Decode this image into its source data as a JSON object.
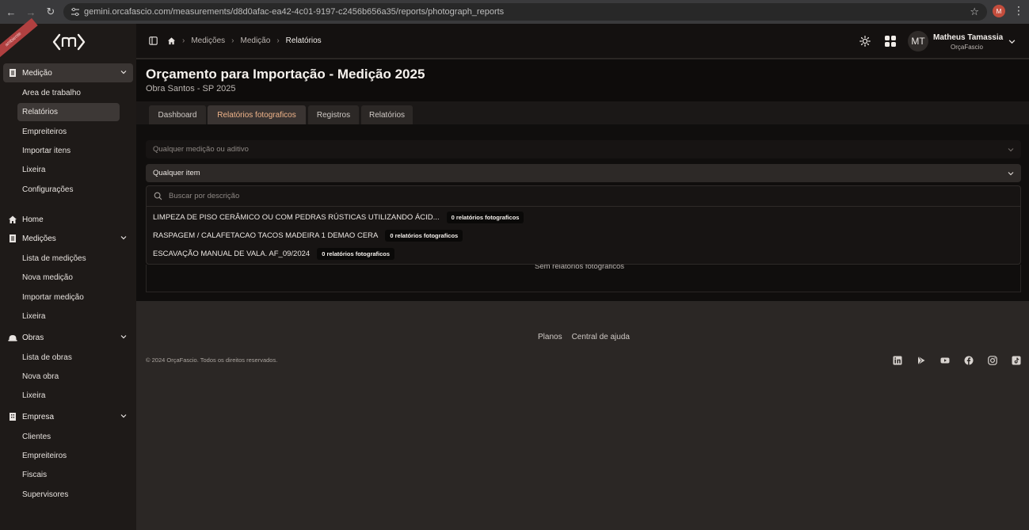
{
  "browser": {
    "url": "gemini.orcafascio.com/measurements/d8d0afac-ea42-4c01-9197-c2456b656a35/reports/photograph_reports",
    "profile_initial": "M"
  },
  "sidebar": {
    "ribbon": "ambiente",
    "sections": [
      {
        "label": "Medição",
        "items": [
          "Area de trabalho",
          "Relatórios",
          "Empreiteiros",
          "Importar itens",
          "Lixeira",
          "Configurações"
        ]
      },
      {
        "label": "Home",
        "items": []
      },
      {
        "label": "Medições",
        "items": [
          "Lista de medições",
          "Nova medição",
          "Importar medição",
          "Lixeira"
        ]
      },
      {
        "label": "Obras",
        "items": [
          "Lista de obras",
          "Nova obra",
          "Lixeira"
        ]
      },
      {
        "label": "Empresa",
        "items": [
          "Clientes",
          "Empreiteiros",
          "Fiscais",
          "Supervisores"
        ]
      }
    ]
  },
  "topbar": {
    "breadcrumbs": [
      "Medições",
      "Medição",
      "Relatórios"
    ],
    "user_initials": "MT",
    "user_name": "Matheus Tamassia",
    "user_org": "OrçaFascio"
  },
  "header": {
    "title": "Orçamento para Importação - Medição 2025",
    "subtitle": "Obra Santos - SP 2025"
  },
  "tabs": [
    "Dashboard",
    "Relatórios fotograficos",
    "Registros",
    "Relatórios"
  ],
  "filters": {
    "measurement_placeholder": "Qualquer medição ou aditivo",
    "item_value": "Qualquer item",
    "search_placeholder": "Buscar por descrição"
  },
  "options": [
    {
      "label": "LIMPEZA DE PISO CERÂMICO OU COM PEDRAS RÚSTICAS UTILIZANDO ÁCID...",
      "badge": "0 relatórios fotograficos"
    },
    {
      "label": "RASPAGEM / CALAFETACAO TACOS MADEIRA 1 DEMAO CERA",
      "badge": "0 relatórios fotograficos"
    },
    {
      "label": "ESCAVAÇÃO MANUAL DE VALA. AF_09/2024",
      "badge": "0 relatórios fotograficos"
    }
  ],
  "empty_text": "Sem relatórios fotograficos",
  "footer": {
    "links": [
      "Planos",
      "Central de ajuda"
    ],
    "copyright": "© 2024 OrçaFascio. Todos os direitos reservados.",
    "social_icons": [
      "linkedin-icon",
      "play-store-icon",
      "youtube-icon",
      "facebook-icon",
      "instagram-icon",
      "tiktok-icon"
    ]
  },
  "colors": {
    "accent_tab": "#f0b48a",
    "sidebar_bg": "#1e1a18",
    "content_bg": "#100e0d"
  }
}
